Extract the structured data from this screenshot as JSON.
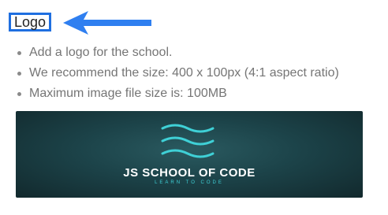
{
  "section": {
    "title": "Logo"
  },
  "guidelines": [
    "Add a logo for the school.",
    "We recommend the size: 400 x 100px (4:1 aspect ratio)",
    "Maximum image file size is: 100MB"
  ],
  "logo_preview": {
    "school_name": "JS SCHOOL OF CODE",
    "tagline": "LEARN TO CODE",
    "wave_color": "#3fd0d6",
    "background_color": "#1c4349"
  },
  "colors": {
    "highlight": "#1f6fe0",
    "arrow": "#2f7ff0",
    "bullet_text": "#757575"
  },
  "icons": {
    "annotation": "arrow-left-icon",
    "logo_mark": "waves-icon"
  }
}
